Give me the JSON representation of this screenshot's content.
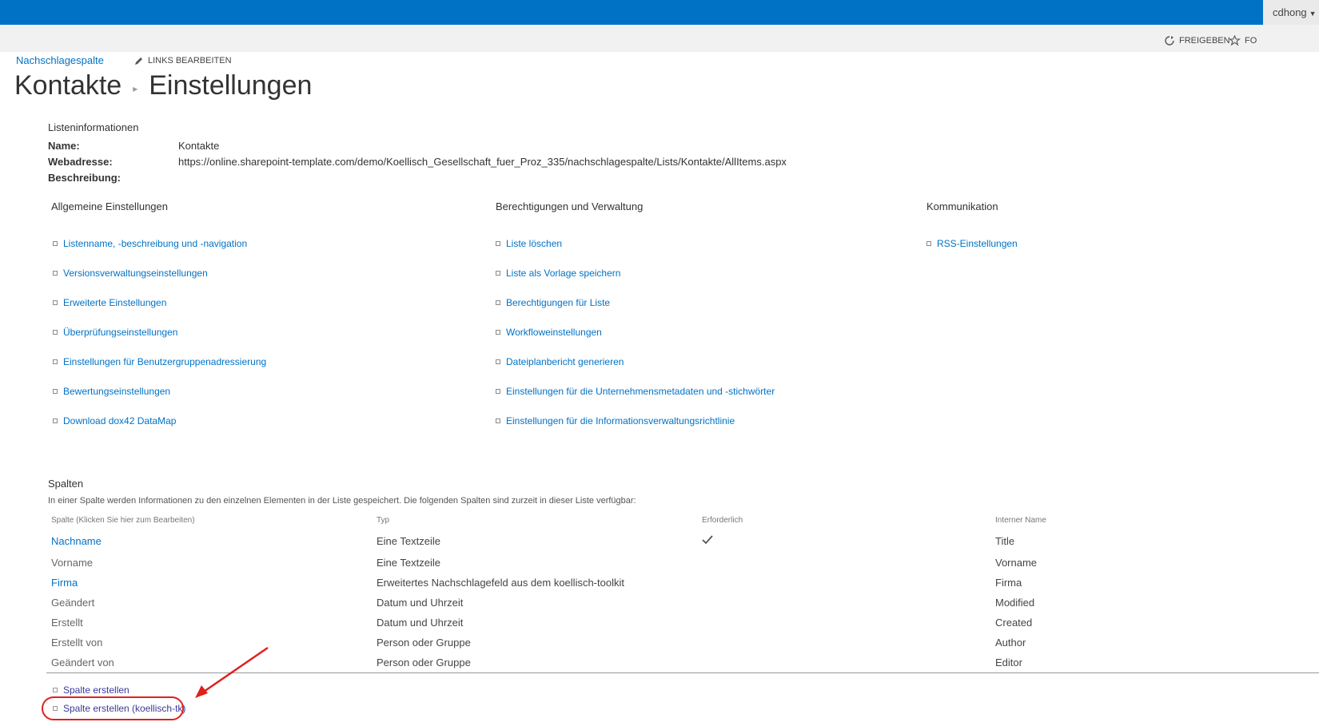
{
  "suitebar": {
    "user": "cdhong",
    "accent": "#0072c6"
  },
  "ribbon": {
    "share_label": "FREIGEBEN",
    "follow_label": "FO"
  },
  "breadcrumb": {
    "nav_link": "Nachschlagespalte",
    "edit_links": "LINKS BEARBEITEN"
  },
  "page_title": {
    "list": "Kontakte",
    "settings": "Einstellungen"
  },
  "list_info": {
    "heading": "Listeninformationen",
    "name_label": "Name:",
    "name_value": "Kontakte",
    "web_label": "Webadresse:",
    "web_value": "https://online.sharepoint-template.com/demo/Koellisch_Gesellschaft_fuer_Proz_335/nachschlagespalte/Lists/Kontakte/AllItems.aspx",
    "desc_label": "Beschreibung:"
  },
  "settings": {
    "general": {
      "heading": "Allgemeine Einstellungen",
      "items": [
        "Listenname, -beschreibung und -navigation",
        "Versionsverwaltungseinstellungen",
        "Erweiterte Einstellungen",
        "Überprüfungseinstellungen",
        "Einstellungen für Benutzergruppenadressierung",
        "Bewertungseinstellungen",
        "Download dox42 DataMap"
      ]
    },
    "permissions": {
      "heading": "Berechtigungen und Verwaltung",
      "items": [
        "Liste löschen",
        "Liste als Vorlage speichern",
        "Berechtigungen für Liste",
        "Workfloweinstellungen",
        "Dateiplanbericht generieren",
        "Einstellungen für die Unternehmensmetadaten und -stichwörter",
        "Einstellungen für die Informationsverwaltungsrichtlinie"
      ]
    },
    "communication": {
      "heading": "Kommunikation",
      "items": [
        "RSS-Einstellungen"
      ]
    }
  },
  "columns": {
    "heading": "Spalten",
    "description": "In einer Spalte werden Informationen zu den einzelnen Elementen in der Liste gespeichert. Die folgenden Spalten sind zurzeit in dieser Liste verfügbar:",
    "headers": [
      "Spalte (Klicken Sie hier zum Bearbeiten)",
      "Typ",
      "Erforderlich",
      "Interner Name"
    ],
    "rows": [
      {
        "name": "Nachname",
        "type": "Eine Textzeile",
        "required": true,
        "internal": "Title",
        "link": true
      },
      {
        "name": "Vorname",
        "type": "Eine Textzeile",
        "required": false,
        "internal": "Vorname",
        "link": false
      },
      {
        "name": "Firma",
        "type": "Erweitertes Nachschlagefeld aus dem koellisch-toolkit",
        "required": false,
        "internal": "Firma",
        "link": true
      },
      {
        "name": "Geändert",
        "type": "Datum und Uhrzeit",
        "required": false,
        "internal": "Modified",
        "link": false
      },
      {
        "name": "Erstellt",
        "type": "Datum und Uhrzeit",
        "required": false,
        "internal": "Created",
        "link": false
      },
      {
        "name": "Erstellt von",
        "type": "Person oder Gruppe",
        "required": false,
        "internal": "Author",
        "link": false
      },
      {
        "name": "Geändert von",
        "type": "Person oder Gruppe",
        "required": false,
        "internal": "Editor",
        "link": false
      }
    ],
    "create_column": "Spalte erstellen",
    "create_column_tk": "Spalte erstellen (koellisch-tk)"
  },
  "annotation": {
    "color": "#e0201c"
  }
}
